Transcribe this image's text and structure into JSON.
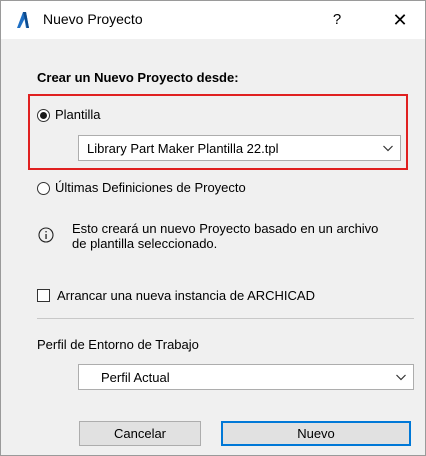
{
  "window": {
    "title": "Nuevo Proyecto",
    "help_label": "?",
    "close_label": "✕"
  },
  "main": {
    "section_title": "Crear un Nuevo Proyecto desde:",
    "option_template": {
      "label": "Plantilla",
      "selected": true,
      "template_file": "Library Part Maker Plantilla 22.tpl"
    },
    "option_last": {
      "label": "Últimas Definiciones de Proyecto",
      "selected": false
    },
    "info_text": "Esto creará un nuevo Proyecto basado en un archivo de plantilla seleccionado.",
    "new_instance": {
      "label": "Arrancar una nueva instancia de ARCHICAD",
      "checked": false
    },
    "work_env": {
      "label": "Perfil de Entorno de Trabajo",
      "value": "Perfil Actual"
    }
  },
  "footer": {
    "cancel_label": "Cancelar",
    "ok_label": "Nuevo"
  },
  "colors": {
    "highlight": "#e02020",
    "accent": "#0078d7",
    "app_icon": "#1e6fc4"
  },
  "icons": {
    "app": "archicad-logo-icon",
    "info": "info-circle-icon",
    "chevron": "chevron-down-icon"
  }
}
